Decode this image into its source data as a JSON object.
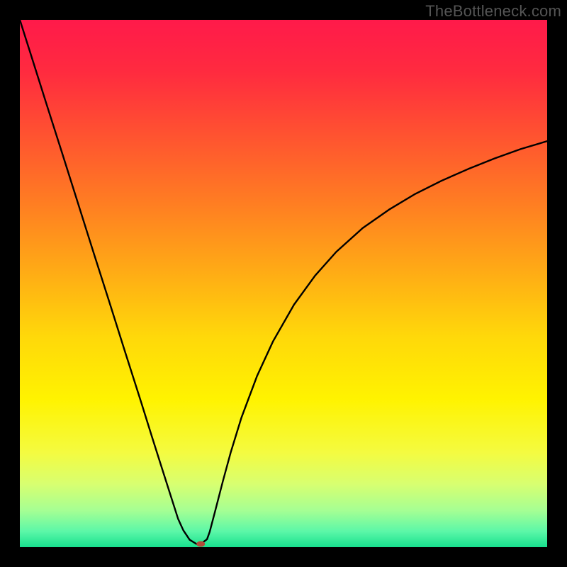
{
  "watermark": "TheBottleneck.com",
  "chart_data": {
    "type": "line",
    "title": "",
    "xlabel": "",
    "ylabel": "",
    "xlim": [
      0,
      100
    ],
    "ylim": [
      0,
      100
    ],
    "background_gradient": {
      "stops": [
        {
          "offset": 0.0,
          "color": "#ff1a4a"
        },
        {
          "offset": 0.1,
          "color": "#ff2b3f"
        },
        {
          "offset": 0.22,
          "color": "#ff5330"
        },
        {
          "offset": 0.35,
          "color": "#ff7e22"
        },
        {
          "offset": 0.48,
          "color": "#ffac15"
        },
        {
          "offset": 0.6,
          "color": "#ffd80a"
        },
        {
          "offset": 0.72,
          "color": "#fff300"
        },
        {
          "offset": 0.82,
          "color": "#f4fb40"
        },
        {
          "offset": 0.88,
          "color": "#d8ff70"
        },
        {
          "offset": 0.93,
          "color": "#a6ff93"
        },
        {
          "offset": 0.97,
          "color": "#5cf7a8"
        },
        {
          "offset": 1.0,
          "color": "#17e08e"
        }
      ]
    },
    "series": [
      {
        "name": "bottleneck-curve",
        "x": [
          0,
          2,
          5,
          8,
          11,
          14,
          17,
          20,
          23,
          25,
          27,
          28.5,
          30,
          31,
          32.2,
          33.5,
          34.0,
          34.3,
          35.5,
          36.0,
          37.0,
          38.5,
          40,
          42,
          45,
          48,
          52,
          56,
          60,
          65,
          70,
          75,
          80,
          85,
          90,
          95,
          100
        ],
        "y": [
          100,
          93.7,
          84.2,
          74.8,
          65.3,
          55.8,
          46.4,
          36.9,
          27.5,
          21.1,
          14.8,
          10.1,
          5.4,
          3.2,
          1.4,
          0.6,
          0.6,
          0.6,
          1.5,
          2.9,
          6.7,
          12.5,
          18.0,
          24.5,
          32.5,
          39.0,
          46.0,
          51.5,
          56.0,
          60.5,
          64.0,
          67.0,
          69.5,
          71.7,
          73.7,
          75.5,
          77.0
        ]
      }
    ],
    "marker": {
      "x": 34.3,
      "y": 0.6,
      "color": "#b24a3a",
      "rx": 6,
      "ry": 4
    }
  }
}
